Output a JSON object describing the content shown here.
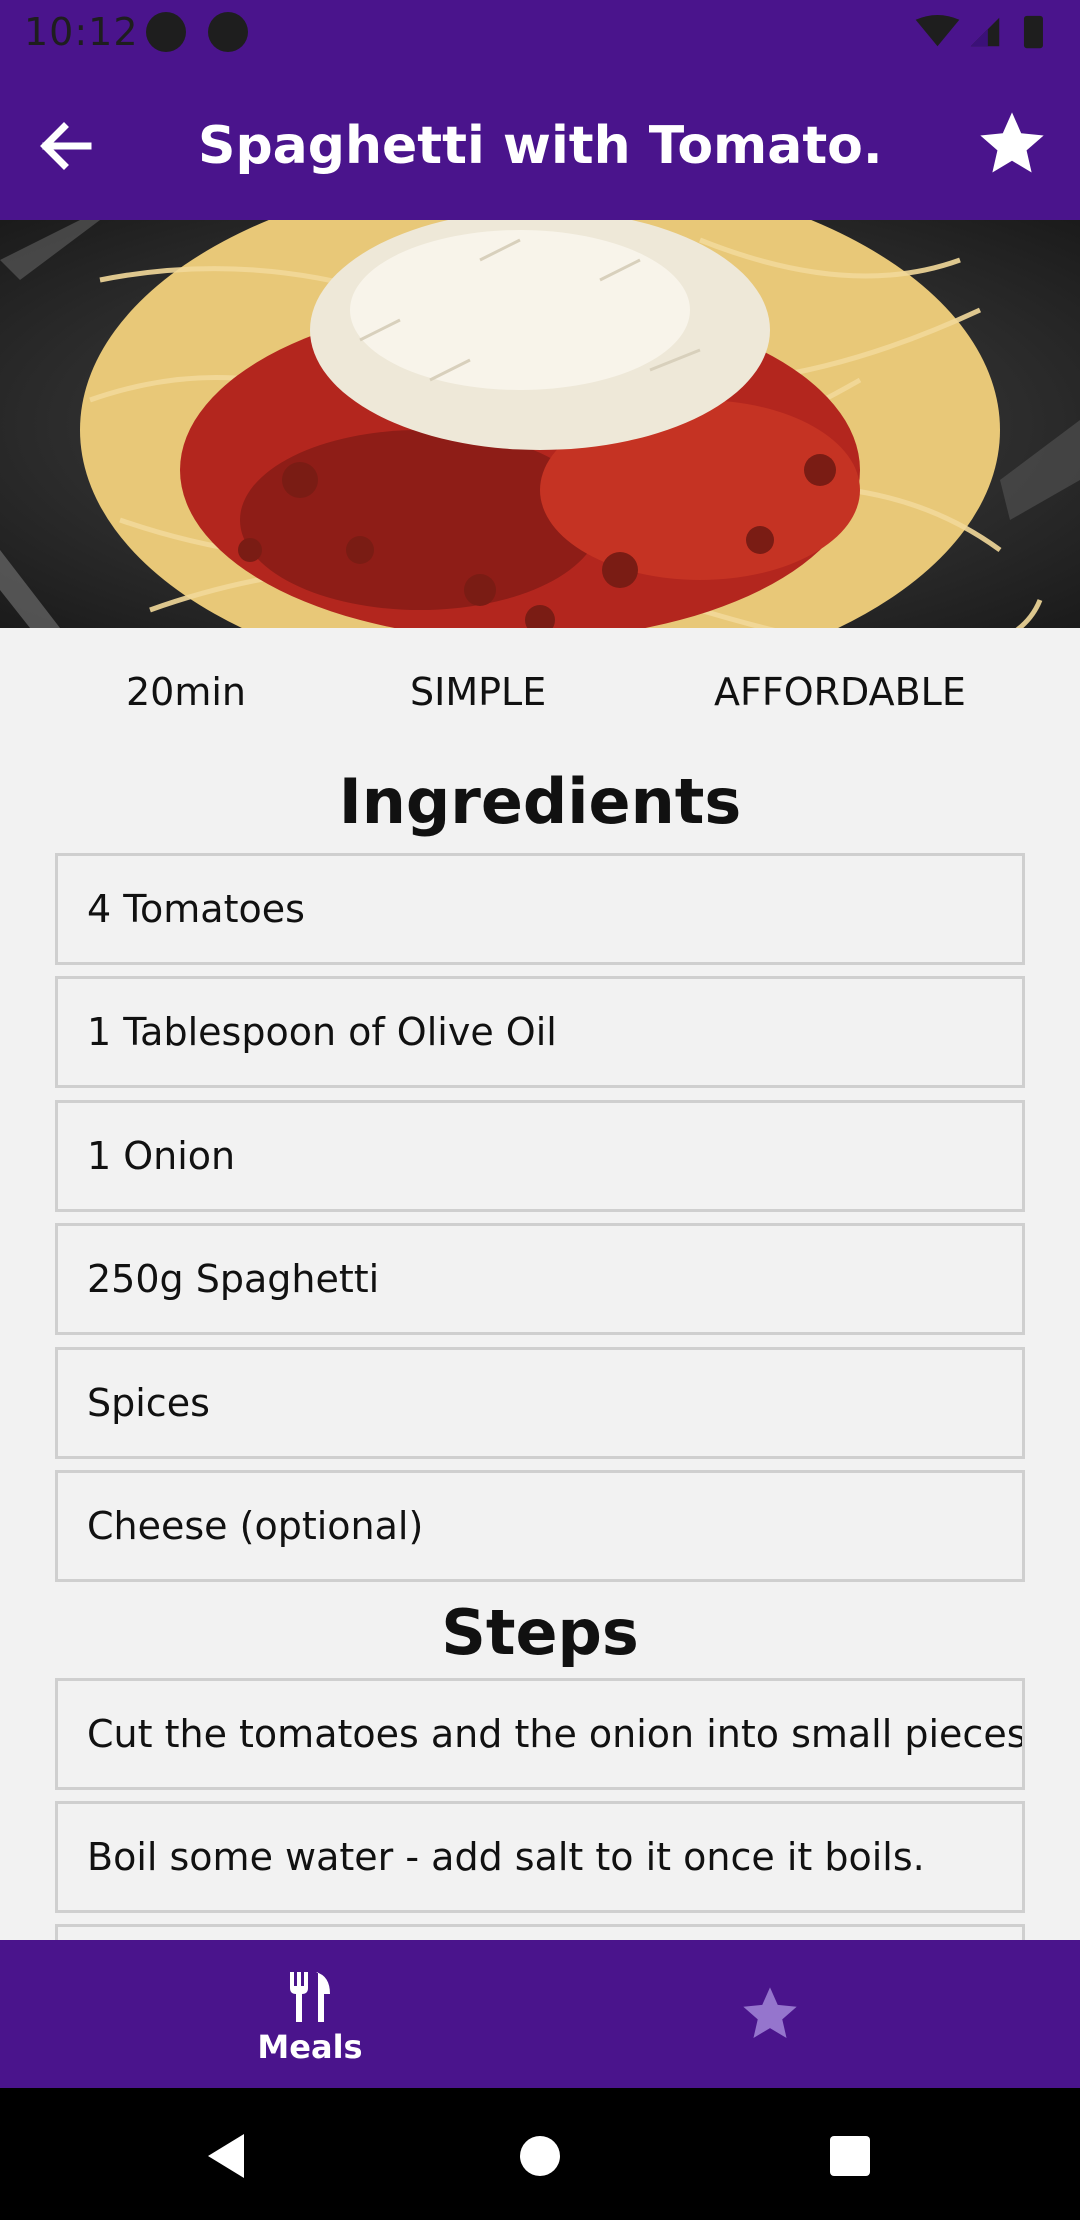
{
  "status_bar": {
    "time": "10:12"
  },
  "app_bar": {
    "title": "Spaghetti with Tomato..."
  },
  "hero": {
    "alt": "Spaghetti with tomato sauce topped with grated cheese"
  },
  "meta": {
    "duration": "20min",
    "complexity": "SIMPLE",
    "affordability": "AFFORDABLE"
  },
  "ingredients": {
    "title": "Ingredients",
    "items": [
      "4 Tomatoes",
      "1 Tablespoon of Olive Oil",
      "1 Onion",
      "250g Spaghetti",
      "Spices",
      "Cheese (optional)"
    ]
  },
  "steps": {
    "title": "Steps",
    "items": [
      "Cut the tomatoes and the onion into small pieces.",
      "Boil some water - add salt to it once it boils."
    ]
  },
  "bottom_nav": {
    "meals_label": "Meals"
  },
  "colors": {
    "primary": "#4a148c",
    "background": "#f2f2f2",
    "fav_inactive": "#9575cd"
  }
}
